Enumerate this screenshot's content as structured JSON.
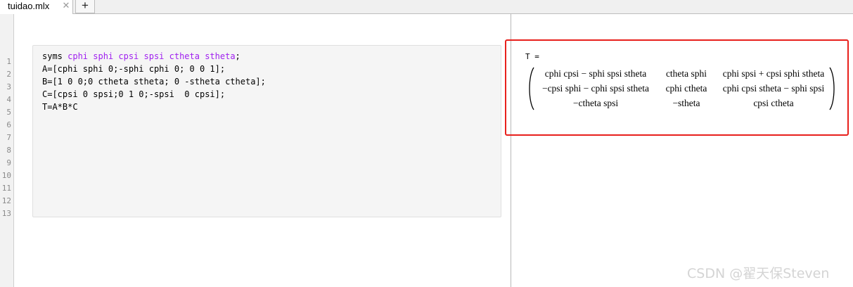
{
  "tab": {
    "title": "tuidao.mlx",
    "close_glyph": "✕",
    "add_glyph": "+"
  },
  "gutter": {
    "line_numbers": [
      "1",
      "2",
      "3",
      "4",
      "5",
      "6",
      "7",
      "8",
      "9",
      "10",
      "11",
      "12",
      "13"
    ]
  },
  "code": {
    "line1_keyword": "syms ",
    "line1_vars": "cphi sphi cpsi spsi ctheta stheta",
    "line1_end": ";",
    "line2": "A=[cphi sphi 0;-sphi cphi 0; 0 0 1];",
    "line3": "B=[1 0 0;0 ctheta stheta; 0 -stheta ctheta];",
    "line4": "C=[cpsi 0 spsi;0 1 0;-spsi  0 cpsi];",
    "line5": "T=A*B*C"
  },
  "output": {
    "label": "T =",
    "matrix": [
      [
        "cphi cpsi − sphi spsi stheta",
        "ctheta sphi",
        "cphi spsi + cpsi sphi stheta"
      ],
      [
        "−cpsi sphi − cphi spsi stheta",
        "cphi ctheta",
        "cphi cpsi stheta − sphi spsi"
      ],
      [
        "−ctheta spsi",
        "−stheta",
        "cpsi ctheta"
      ]
    ]
  },
  "colors": {
    "variable_purple": "#a020f0",
    "highlight_red": "#e8201c"
  },
  "watermark": "CSDN @翟天保Steven"
}
